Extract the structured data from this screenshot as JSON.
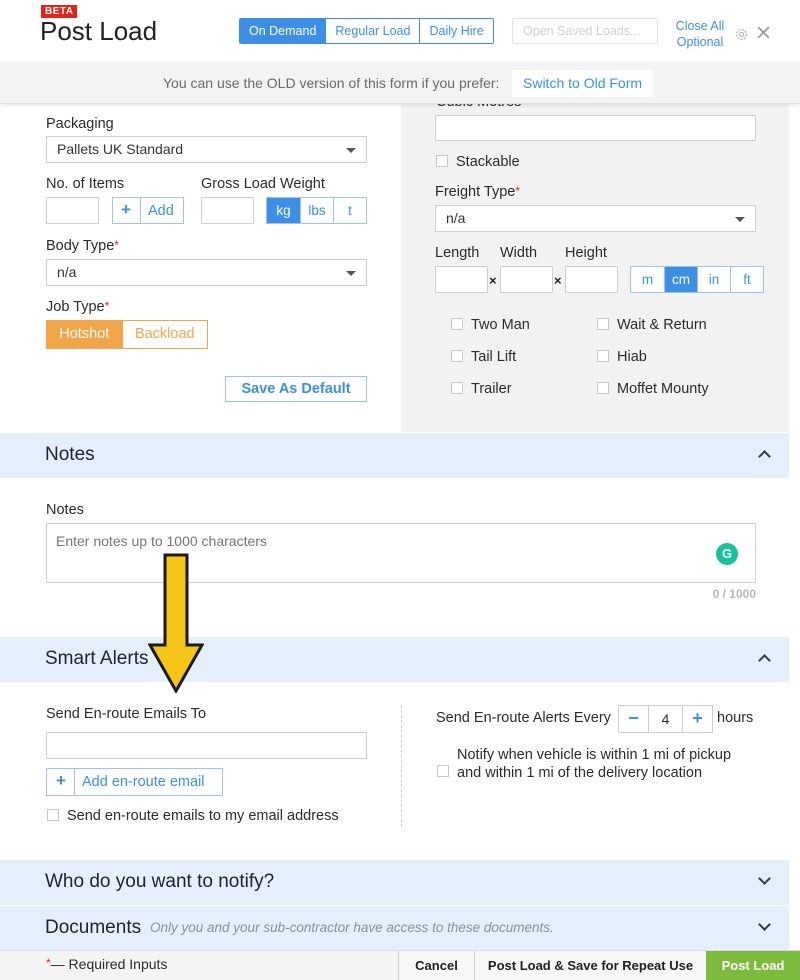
{
  "header": {
    "beta": "BETA",
    "title": "Post Load",
    "tabs": [
      "On Demand",
      "Regular Load",
      "Daily Hire"
    ],
    "open_saved_placeholder": "Open Saved Loads...",
    "close_all_line1": "Close All",
    "close_all_line2": "Optional"
  },
  "banner": {
    "text": "You can use the OLD version of this form if you prefer:",
    "button": "Switch to Old Form"
  },
  "left": {
    "packaging_label": "Packaging",
    "packaging_value": "Pallets UK Standard",
    "items_label": "No. of Items",
    "add_label": "Add",
    "weight_label": "Gross Load Weight",
    "weight_units": [
      "kg",
      "lbs",
      "t"
    ],
    "body_type_label": "Body Type",
    "body_type_value": "n/a",
    "job_type_label": "Job Type",
    "job_types": [
      "Hotshot",
      "Backload"
    ],
    "save_default": "Save As Default"
  },
  "right": {
    "cubic_label": "Cubic Metres",
    "stackable": "Stackable",
    "freight_label": "Freight Type",
    "freight_value": "n/a",
    "length": "Length",
    "width": "Width",
    "height": "Height",
    "dim_units": [
      "m",
      "cm",
      "in",
      "ft"
    ],
    "options": [
      "Two Man",
      "Wait & Return",
      "Tail Lift",
      "Hiab",
      "Trailer",
      "Moffet Mounty"
    ]
  },
  "notes": {
    "section": "Notes",
    "label": "Notes",
    "placeholder": "Enter notes up to 1000 characters",
    "counter": "0 / 1000"
  },
  "smart_alerts": {
    "section": "Smart Alerts",
    "emails_label": "Send En-route Emails To",
    "add_email": "Add en-route email",
    "send_to_me": "Send en-route emails to my email address",
    "every_label": "Send En-route Alerts Every",
    "hours_value": "4",
    "hours_label": "hours",
    "notify_line1": "Notify when vehicle is within 1 mi of pickup",
    "notify_line2": "and within 1 mi of the delivery location"
  },
  "who_notify": {
    "section": "Who do you want to notify?"
  },
  "documents": {
    "section": "Documents",
    "note": "Only you and your sub-contractor have access to these documents."
  },
  "footer": {
    "required_star": "*",
    "required_text": "— Required Inputs",
    "cancel": "Cancel",
    "save_repeat": "Post Load & Save for Repeat Use",
    "post": "Post Load"
  },
  "colors": {
    "accent": "#3d8fe6",
    "orange": "#f0a548",
    "post_green": "#7dbb3c",
    "section_bg": "#e4effb",
    "arrow": "#f5c518"
  }
}
